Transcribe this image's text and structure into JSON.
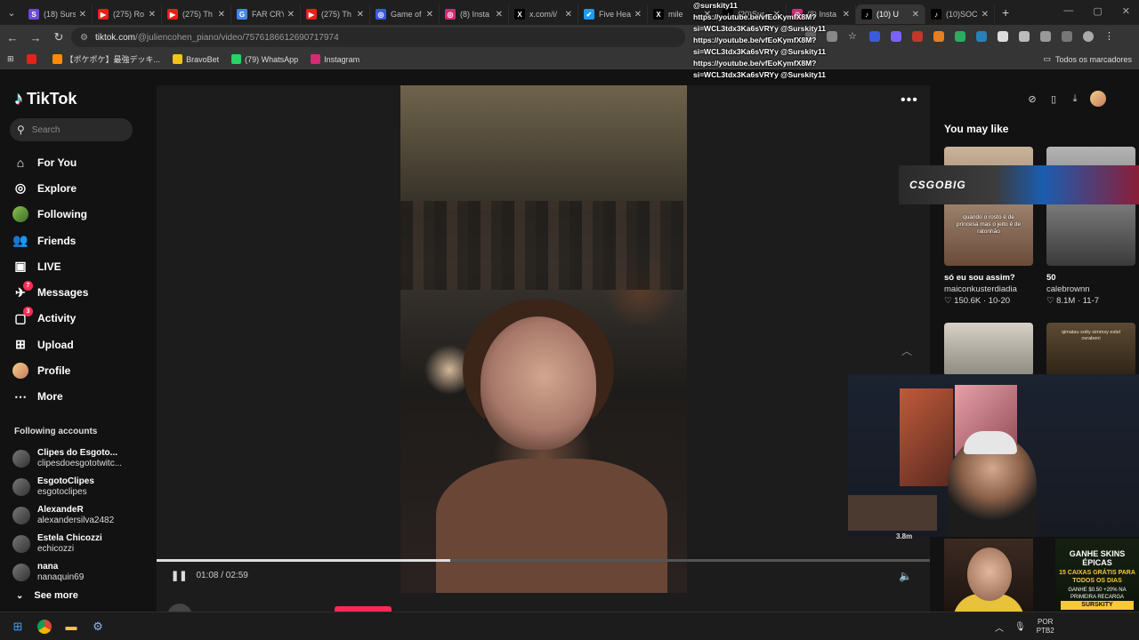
{
  "browser": {
    "tabs": [
      {
        "label": "(18) Surs",
        "color": "#6c4bd8",
        "glyph": "S"
      },
      {
        "label": "(275) Ro",
        "color": "#e62117",
        "glyph": "▶"
      },
      {
        "label": "(275) Th",
        "color": "#e62117",
        "glyph": "▶"
      },
      {
        "label": "FAR CRY",
        "color": "#4285f4",
        "glyph": "G"
      },
      {
        "label": "(275) Th",
        "color": "#e62117",
        "glyph": "▶"
      },
      {
        "label": "Game of",
        "color": "#3b5bdb",
        "glyph": "◎"
      },
      {
        "label": "(8) Insta",
        "color": "#d62976",
        "glyph": "◎"
      },
      {
        "label": "x.com/i/",
        "color": "#000000",
        "glyph": "X"
      },
      {
        "label": "Five Hea",
        "color": "#1d9bf0",
        "glyph": "✔"
      },
      {
        "label": "mile",
        "color": "#000000",
        "glyph": "X"
      },
      {
        "label": "(20)Sur",
        "color": "#000000",
        "glyph": "♪"
      },
      {
        "label": "(8) Insta",
        "color": "#d62976",
        "glyph": "◎"
      },
      {
        "label": "(10) U",
        "color": "#000000",
        "glyph": "♪",
        "active": true
      },
      {
        "label": "(10)SOC",
        "color": "#000000",
        "glyph": "♪"
      }
    ],
    "new_tab": "+",
    "url_host": "tiktok.com",
    "url_path": "/@juliencohen_piano/video/7576186612690717974",
    "bookmarks": [
      {
        "label": "",
        "color": "#e62117"
      },
      {
        "label": "【ポケポケ】最強デッキ...",
        "color": "#ff8c00"
      },
      {
        "label": "BravoBet",
        "color": "#f0c419"
      },
      {
        "label": "(79) WhatsApp",
        "color": "#25d366"
      },
      {
        "label": "Instagram",
        "color": "#d62976"
      }
    ],
    "all_bookmarks": "Todos os marcadores"
  },
  "chat_overlay": [
    "@surskity11",
    "https://youtube.be/vfEoKymfX8M?",
    "si=WCL3tdx3Ka6sVRYy @Surskity11",
    "https://youtube.be/vfEoKymfX8M?",
    "si=WCL3tdx3Ka6sVRYy @Surskity11",
    "https://youtube.be/vfEoKymfX8M?",
    "si=WCL3tdx3Ka6sVRYy @Surskity11"
  ],
  "tiktok": {
    "logo": "TikTok",
    "search_placeholder": "Search",
    "nav": [
      {
        "label": "For You",
        "icon": "home-icon",
        "glyph": "⌂"
      },
      {
        "label": "Explore",
        "icon": "compass-icon",
        "glyph": "◎"
      },
      {
        "label": "Following",
        "icon": "following-avatar-icon",
        "glyph": "●"
      },
      {
        "label": "Friends",
        "icon": "friends-icon",
        "glyph": "👥"
      },
      {
        "label": "LIVE",
        "icon": "live-icon",
        "glyph": "▣"
      },
      {
        "label": "Messages",
        "icon": "messages-icon",
        "glyph": "✈",
        "badge": "7"
      },
      {
        "label": "Activity",
        "icon": "activity-icon",
        "glyph": "▢",
        "badge": "3"
      },
      {
        "label": "Upload",
        "icon": "upload-icon",
        "glyph": "⊞"
      },
      {
        "label": "Profile",
        "icon": "profile-icon",
        "glyph": "●"
      },
      {
        "label": "More",
        "icon": "more-icon",
        "glyph": "⋯"
      }
    ],
    "following_title": "Following accounts",
    "following": [
      {
        "name": "Clipes do Esgoto...",
        "handle": "clipesdoesgototwitc..."
      },
      {
        "name": "EsgotoClipes",
        "handle": "esgotoclipes"
      },
      {
        "name": "AlexandeR",
        "handle": "alexandersilva2482"
      },
      {
        "name": "Estela Chicozzi",
        "handle": "echicozzi"
      },
      {
        "name": "nana",
        "handle": "nanaquin69"
      }
    ],
    "see_more": "See more",
    "player": {
      "time": "01:08 / 02:59",
      "progress": 0.38,
      "author": "juliencohen_piano"
    },
    "you_may_like": "You may like",
    "suggestions": [
      {
        "title": "só eu sou assim?",
        "author": "maiconkusterdiadia",
        "stats": "♡ 150.6K · 10-20",
        "caption": "quando o rosto é de princesa mas o jeito é de ratonhão"
      },
      {
        "title": "50",
        "author": "calebrownn",
        "stats": "♡ 8.1M · 11-7",
        "caption": ""
      },
      {
        "title": "",
        "author": "",
        "stats": "",
        "caption": ""
      },
      {
        "title": "",
        "author": "",
        "stats": "",
        "caption": "qimatau sotty simmsy estel ovrabeni"
      }
    ]
  },
  "overlays": {
    "csgo_brand": "CSGOBIG",
    "stream_number": "3.8m",
    "keydrop_title": "GANHE SKINS ÉPICAS",
    "keydrop_sub": "15 CAIXAS GRÁTIS PARA TODOS OS DIAS",
    "keydrop_promo": "GANHE $0.50 +20% NA PRIMEIRA RECARGA",
    "keydrop_code": "SURSKITY"
  },
  "taskbar": {
    "lang": "POR",
    "lang2": "PTB2"
  }
}
